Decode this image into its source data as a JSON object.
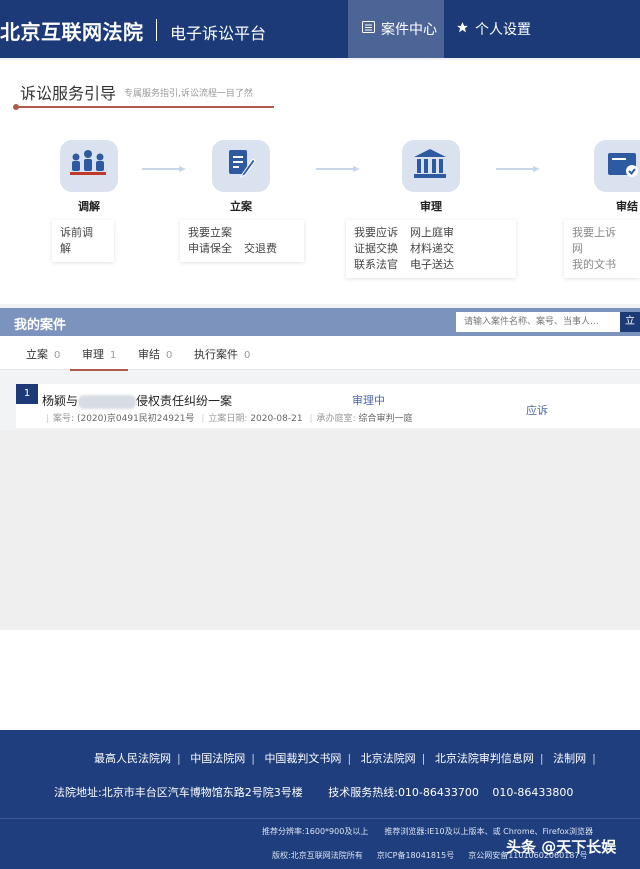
{
  "header": {
    "site_title": "北京互联网法院",
    "platform_name": "电子诉讼平台",
    "nav": [
      {
        "label": "案件中心",
        "icon": "list-icon",
        "active": true
      },
      {
        "label": "个人设置",
        "icon": "star-icon",
        "active": false
      }
    ]
  },
  "guide": {
    "title": "诉讼服务引导",
    "subtitle": "专属服务指引,诉讼流程一目了然",
    "steps": [
      {
        "label": "调解",
        "icon": "people-icon",
        "links": [
          "诉前调解"
        ]
      },
      {
        "label": "立案",
        "icon": "edit-document-icon",
        "links": [
          "我要立案",
          "申请保全",
          "交退费"
        ]
      },
      {
        "label": "审理",
        "icon": "courthouse-icon",
        "links": [
          "我要应诉",
          "网上庭审",
          "证据交换",
          "材料递交",
          "联系法官",
          "电子送达"
        ]
      },
      {
        "label": "审结",
        "icon": "verdict-document-icon",
        "links": [
          "我要上诉",
          "网",
          "我的文书"
        ]
      }
    ]
  },
  "cases": {
    "title": "我的案件",
    "search_placeholder": "请输入案件名称、案号、当事人...",
    "search_button": "立",
    "tabs": [
      {
        "label": "立案",
        "count": "0"
      },
      {
        "label": "审理",
        "count": "1"
      },
      {
        "label": "审结",
        "count": "0"
      },
      {
        "label": "执行案件",
        "count": "0"
      }
    ],
    "rows": [
      {
        "index": "1",
        "title_prefix": "杨颖与",
        "title_suffix": "侵权责任纠纷一案",
        "case_no_label": "案号:",
        "case_no": "(2020)京0491民初24921号",
        "filed_label": "立案日期:",
        "filed_date": "2020-08-21",
        "court_label": "承办庭室:",
        "court": "综合审判一庭",
        "status": "审理中",
        "action": "应诉"
      }
    ]
  },
  "footer": {
    "links": [
      "最高人民法院网",
      "中国法院网",
      "中国裁判文书网",
      "北京法院网",
      "北京法院审判信息网",
      "法制网"
    ],
    "address_label": "法院地址:",
    "address": "北京市丰台区汽车博物馆东路2号院3号楼",
    "hotline_label": "技术服务热线:",
    "hotline_1": "010-86433700",
    "hotline_2": "010-86433800",
    "resolution": "推荐分辨率:1600*900及以上",
    "browser": "推荐浏览器:IE10及以上版本、或 Chrome、Firefox浏览器",
    "copyright": "版权:北京互联网法院所有",
    "icp": "京ICP备18041815号",
    "police_record": "京公网安备11010602060187号",
    "watermark": "头条 @天下长娱"
  }
}
